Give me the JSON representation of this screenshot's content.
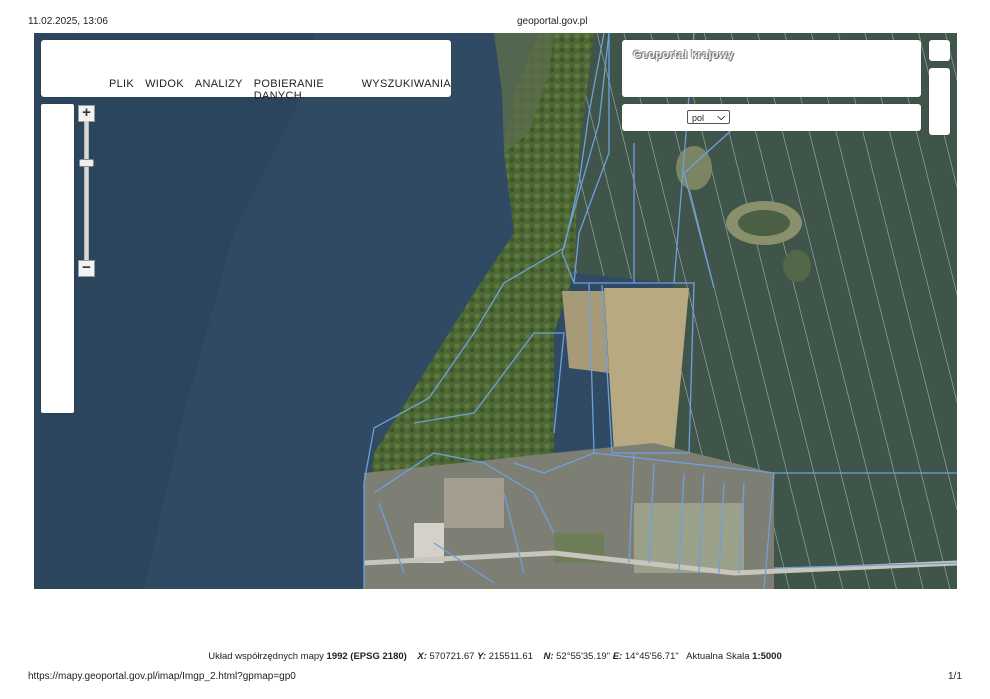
{
  "print_header": {
    "datetime": "11.02.2025, 13:06",
    "site": "geoportal.gov.pl"
  },
  "print_footer": {
    "url": "https://mapy.geoportal.gov.pl/imap/Imgp_2.html?gpmap=gp0",
    "page": "1/1"
  },
  "menu": {
    "items": [
      "PLIK",
      "WIDOK",
      "ANALIZY",
      "POBIERANIE DANYCH",
      "WYSZUKIWANIA"
    ]
  },
  "zoom": {
    "in_symbol": "+",
    "out_symbol": "−"
  },
  "title_panel": {
    "title": "Geoportal krajowy"
  },
  "language": {
    "selected": "pol"
  },
  "coords": {
    "system_label": "Układ współrzędnych mapy",
    "system_value": "1992 (EPSG 2180)",
    "x_label": "X:",
    "x_value": "570721.67",
    "y_label": "Y:",
    "y_value": "215511.61",
    "n_label": "N:",
    "n_value": "52°55'35.19\"",
    "e_label": "E:",
    "e_value": "14°45'56.71\"",
    "scale_label": "Aktualna Skala",
    "scale_value": "1:5000"
  },
  "colors": {
    "water": "#2f4a62",
    "parcel_lines": "#6fa0dc",
    "forest": "#4f6a35",
    "fields": "#455a4c"
  }
}
